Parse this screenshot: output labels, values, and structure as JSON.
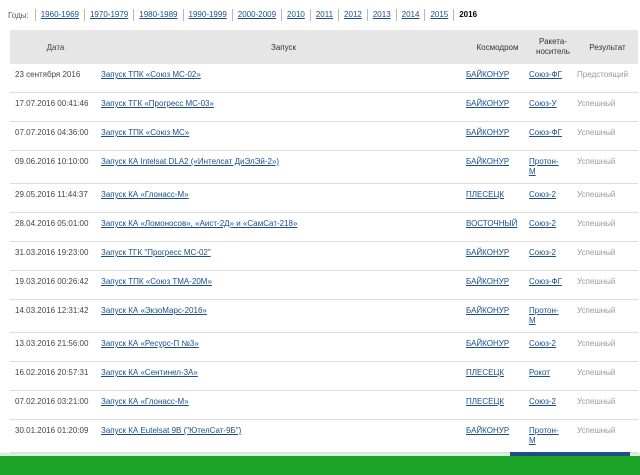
{
  "years_label": "Годы:",
  "years": [
    "1960-1969",
    "1970-1979",
    "1980-1989",
    "1990-1999",
    "2000-2009",
    "2010",
    "2011",
    "2012",
    "2013",
    "2014",
    "2015",
    "2016"
  ],
  "active_year": "2016",
  "columns": {
    "date": "Дата",
    "launch": "Запуск",
    "cosmodrome": "Космодром",
    "rocket": "Ракета-носитель",
    "result": "Результат"
  },
  "rows": [
    {
      "date": "23 сентября 2016",
      "launch": "Запуск ТПК «Союз МС-02»",
      "cosmodrome": "БАЙКОНУР",
      "rocket": "Союз-ФГ",
      "result": "Предстоящий"
    },
    {
      "date": "17.07.2016 00:41:46",
      "launch": "Запуск ТГК «Прогресс МС-03»",
      "cosmodrome": "БАЙКОНУР",
      "rocket": "Союз-У",
      "result": "Успешный"
    },
    {
      "date": "07.07.2016 04:36:00",
      "launch": "Запуск ТПК «Союз МС»",
      "cosmodrome": "БАЙКОНУР",
      "rocket": "Союз-ФГ",
      "result": "Успешный"
    },
    {
      "date": "09.06.2016 10:10:00",
      "launch": "Запуск КА Intelsat DLA2 («Интелсат ДиЭлЭй-2»)",
      "cosmodrome": "БАЙКОНУР",
      "rocket": "Протон-М",
      "result": "Успешный"
    },
    {
      "date": "29.05.2016 11:44:37",
      "launch": "Запуск КА «Глонасс-М»",
      "cosmodrome": "ПЛЕСЕЦК",
      "rocket": "Союз-2",
      "result": "Успешный"
    },
    {
      "date": "28.04.2016 05:01:00",
      "launch": "Запуск КА «Ломоносов», «Аист-2Д» и «СамСат-218»",
      "cosmodrome": "ВОСТОЧНЫЙ",
      "rocket": "Союз-2",
      "result": "Успешный"
    },
    {
      "date": "31.03.2016 19:23:00",
      "launch": "Запуск ТГК \"Прогресс МС-02\"",
      "cosmodrome": "БАЙКОНУР",
      "rocket": "Союз-2",
      "result": "Успешный"
    },
    {
      "date": "19.03.2016 00:26:42",
      "launch": "Запуск ТПК «Союз ТМА-20М»",
      "cosmodrome": "БАЙКОНУР",
      "rocket": "Союз-ФГ",
      "result": "Успешный"
    },
    {
      "date": "14.03.2016 12:31:42",
      "launch": "Запуск КА «ЭкзоМарс-2016»",
      "cosmodrome": "БАЙКОНУР",
      "rocket": "Протон-М",
      "result": "Успешный"
    },
    {
      "date": "13.03.2016 21:56:00",
      "launch": "Запуск КА «Ресурс-П №3»",
      "cosmodrome": "БАЙКОНУР",
      "rocket": "Союз-2",
      "result": "Успешный"
    },
    {
      "date": "16.02.2016 20:57:31",
      "launch": "Запуск КА «Сентинел-3А»",
      "cosmodrome": "ПЛЕСЕЦК",
      "rocket": "Рокот",
      "result": "Успешный"
    },
    {
      "date": "07.02.2016 03:21:00",
      "launch": "Запуск КА «Глонасс-М»",
      "cosmodrome": "ПЛЕСЕЦК",
      "rocket": "Союз-2",
      "result": "Успешный"
    },
    {
      "date": "30.01.2016 01:20:09",
      "launch": "Запуск КА Eutelsat 9B (\"ЮтелСат-9Б\")",
      "cosmodrome": "БАЙКОНУР",
      "rocket": "Протон-М",
      "result": "Успешный"
    }
  ],
  "colors": {
    "link": "#1a4f8a",
    "header_bg": "#e6e6e6",
    "footer": "#1aa325"
  }
}
